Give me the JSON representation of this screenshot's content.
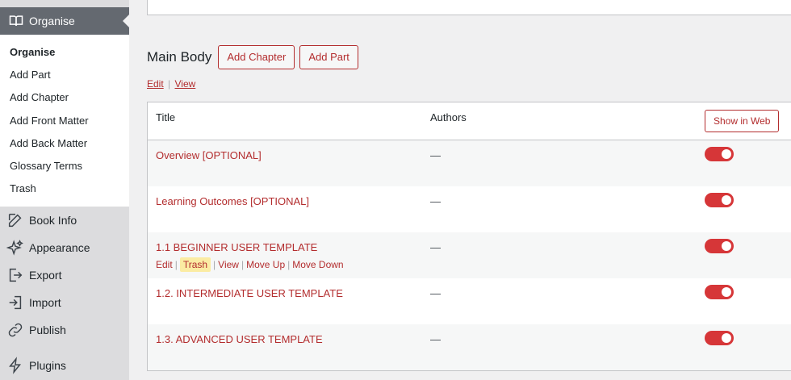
{
  "sidebar": {
    "current": "Organise",
    "submenu": [
      "Organise",
      "Add Part",
      "Add Chapter",
      "Add Front Matter",
      "Add Back Matter",
      "Glossary Terms",
      "Trash"
    ],
    "menu": [
      {
        "label": "Book Info",
        "icon": "edit-icon"
      },
      {
        "label": "Appearance",
        "icon": "sparkle-icon"
      },
      {
        "label": "Export",
        "icon": "export-icon"
      },
      {
        "label": "Import",
        "icon": "import-icon"
      },
      {
        "label": "Publish",
        "icon": "publish-icon"
      },
      {
        "label": "Plugins",
        "icon": "plugins-icon"
      }
    ]
  },
  "main": {
    "section_title": "Main Body",
    "add_chapter": "Add Chapter",
    "add_part": "Add Part",
    "edit_link": "Edit",
    "link_sep": "|",
    "view_link": "View",
    "table": {
      "col_title": "Title",
      "col_authors": "Authors",
      "show_in_web": "Show in Web",
      "rows": [
        {
          "title": "Overview [OPTIONAL]",
          "author": "—"
        },
        {
          "title": "Learning Outcomes [OPTIONAL]",
          "author": "—"
        },
        {
          "title": "1.1 BEGINNER USER TEMPLATE",
          "author": "—",
          "actions": [
            "Edit",
            "Trash",
            "View",
            "Move Up",
            "Move Down"
          ]
        },
        {
          "title": "1.2. INTERMEDIATE USER TEMPLATE",
          "author": "—"
        },
        {
          "title": "1.3. ADVANCED USER TEMPLATE",
          "author": "—"
        }
      ]
    }
  },
  "colors": {
    "accent": "#b32d2e",
    "toggle_on": "#d63638",
    "highlight": "#fbeca3"
  }
}
